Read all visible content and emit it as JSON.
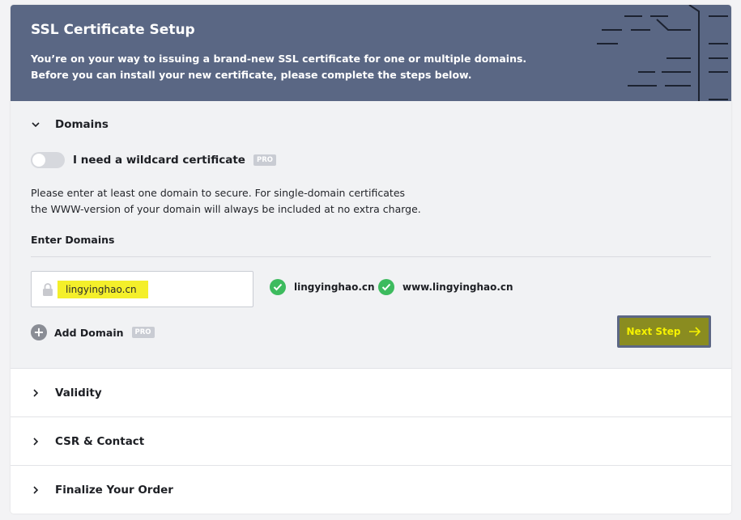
{
  "header": {
    "title": "SSL Certificate Setup",
    "subtitle_line1": "You’re on your way to issuing a brand-new SSL certificate for one or multiple domains.",
    "subtitle_line2": "Before you can install your new certificate, please complete the steps below."
  },
  "domains": {
    "heading": "Domains",
    "wildcard_label": "I need a wildcard certificate",
    "wildcard_badge": "PRO",
    "wildcard_enabled": false,
    "desc_line1": "Please enter at least one domain to secure. For single-domain certificates",
    "desc_line2": "the WWW-version of your domain will always be included at no extra charge.",
    "enter_label": "Enter Domains",
    "input_value": "lingyinghao.cn",
    "verified": [
      "lingyinghao.cn",
      "www.lingyinghao.cn"
    ],
    "add_label": "Add Domain",
    "add_badge": "PRO",
    "next_label": "Next Step"
  },
  "sections": [
    "Validity",
    "CSR & Contact",
    "Finalize Your Order"
  ],
  "colors": {
    "header_bg": "#5a6784",
    "check_green": "#3dbb5e",
    "highlight": "#f4ef2a"
  }
}
